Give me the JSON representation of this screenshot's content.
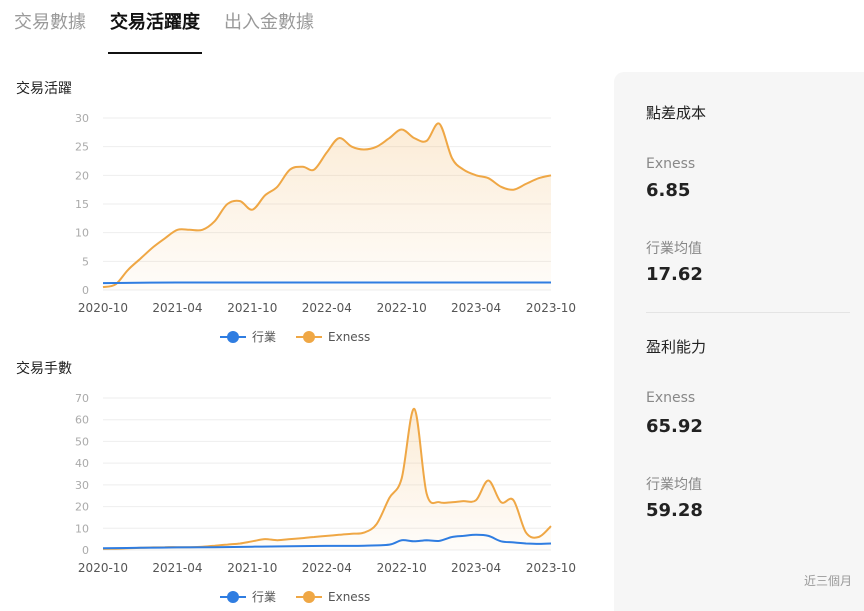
{
  "tabs": [
    {
      "label": "交易數據",
      "active": false
    },
    {
      "label": "交易活躍度",
      "active": true
    },
    {
      "label": "出入金數據",
      "active": false
    }
  ],
  "legend": {
    "industry": "行業",
    "broker": "Exness"
  },
  "colors": {
    "industry": "#2f7de1",
    "broker": "#efa745",
    "grid": "#eeeeee"
  },
  "panel": {
    "spread_title": "點差成本",
    "spread_broker_label": "Exness",
    "spread_broker_value": "6.85",
    "spread_industry_label": "行業均值",
    "spread_industry_value": "17.62",
    "profit_title": "盈利能力",
    "profit_broker_label": "Exness",
    "profit_broker_value": "65.92",
    "profit_industry_label": "行業均值",
    "profit_industry_value": "59.28",
    "footnote": "近三個月"
  },
  "chart_data": [
    {
      "type": "area",
      "title": "交易活躍",
      "x_tick_labels": [
        "2020-10",
        "2021-04",
        "2021-10",
        "2022-04",
        "2022-10",
        "2023-04",
        "2023-10"
      ],
      "x_range": [
        "2020-10-01",
        "2023-10-01"
      ],
      "ylim": [
        0,
        30
      ],
      "y_ticks": [
        0,
        5,
        10,
        15,
        20,
        25,
        30
      ],
      "grid": true,
      "legend_position": "bottom-center",
      "series": [
        {
          "name": "行業",
          "x": [
            "2020-10-01",
            "2021-04-01",
            "2021-10-01",
            "2022-04-01",
            "2022-10-01",
            "2023-04-01",
            "2023-10-01"
          ],
          "y": [
            1.2,
            1.3,
            1.3,
            1.3,
            1.3,
            1.3,
            1.3
          ]
        },
        {
          "name": "Exness",
          "x": [
            "2020-10-01",
            "2020-11-01",
            "2020-12-01",
            "2021-01-01",
            "2021-02-01",
            "2021-03-01",
            "2021-04-01",
            "2021-05-01",
            "2021-06-01",
            "2021-07-01",
            "2021-08-01",
            "2021-09-01",
            "2021-10-01",
            "2021-11-01",
            "2021-12-01",
            "2022-01-01",
            "2022-02-01",
            "2022-03-01",
            "2022-04-01",
            "2022-05-01",
            "2022-06-01",
            "2022-07-01",
            "2022-08-01",
            "2022-09-01",
            "2022-10-01",
            "2022-11-01",
            "2022-12-01",
            "2023-01-01",
            "2023-02-01",
            "2023-03-01",
            "2023-04-01",
            "2023-05-01",
            "2023-06-01",
            "2023-07-01",
            "2023-08-01",
            "2023-09-01",
            "2023-10-01"
          ],
          "y": [
            0.5,
            1.0,
            3.5,
            5.5,
            7.5,
            9.0,
            10.5,
            10.5,
            10.5,
            12.0,
            15.0,
            15.5,
            14.0,
            16.5,
            18.0,
            21.0,
            21.5,
            21.0,
            24.0,
            26.5,
            25.0,
            24.5,
            25.0,
            26.5,
            28.0,
            26.5,
            26.0,
            29.0,
            23.0,
            21.0,
            20.0,
            19.5,
            18.0,
            17.5,
            18.5,
            19.5,
            20.0
          ]
        }
      ]
    },
    {
      "type": "area",
      "title": "交易手數",
      "x_tick_labels": [
        "2020-10",
        "2021-04",
        "2021-10",
        "2022-04",
        "2022-10",
        "2023-04",
        "2023-10"
      ],
      "x_range": [
        "2020-10-01",
        "2023-10-01"
      ],
      "ylim": [
        0,
        70
      ],
      "y_ticks": [
        0,
        10,
        20,
        30,
        40,
        50,
        60,
        70
      ],
      "grid": true,
      "legend_position": "bottom-center",
      "series": [
        {
          "name": "行業",
          "x": [
            "2020-10-01",
            "2021-01-01",
            "2021-04-01",
            "2021-07-01",
            "2021-10-01",
            "2022-01-01",
            "2022-04-01",
            "2022-07-01",
            "2022-09-01",
            "2022-10-01",
            "2022-11-01",
            "2022-12-01",
            "2023-01-01",
            "2023-02-01",
            "2023-03-01",
            "2023-04-01",
            "2023-05-01",
            "2023-06-01",
            "2023-07-01",
            "2023-08-01",
            "2023-09-01",
            "2023-10-01"
          ],
          "y": [
            0.8,
            1.0,
            1.2,
            1.3,
            1.5,
            1.7,
            1.9,
            2.0,
            2.5,
            4.5,
            4.0,
            4.5,
            4.2,
            6.0,
            6.5,
            7.0,
            6.5,
            4.0,
            3.5,
            3.0,
            2.8,
            3.0
          ]
        },
        {
          "name": "Exness",
          "x": [
            "2020-10-01",
            "2020-11-01",
            "2020-12-01",
            "2021-01-01",
            "2021-02-01",
            "2021-03-01",
            "2021-04-01",
            "2021-05-01",
            "2021-06-01",
            "2021-07-01",
            "2021-08-01",
            "2021-09-01",
            "2021-10-01",
            "2021-11-01",
            "2021-12-01",
            "2022-01-01",
            "2022-02-01",
            "2022-03-01",
            "2022-04-01",
            "2022-05-01",
            "2022-06-01",
            "2022-07-01",
            "2022-08-01",
            "2022-09-01",
            "2022-10-01",
            "2022-11-01",
            "2022-12-01",
            "2023-01-01",
            "2023-02-01",
            "2023-03-01",
            "2023-04-01",
            "2023-05-01",
            "2023-06-01",
            "2023-07-01",
            "2023-08-01",
            "2023-09-01",
            "2023-10-01"
          ],
          "y": [
            0.5,
            0.6,
            0.8,
            1.0,
            1.2,
            1.3,
            1.3,
            1.3,
            1.5,
            2.0,
            2.5,
            3.0,
            4.0,
            5.0,
            4.5,
            5.0,
            5.5,
            6.0,
            6.5,
            7.0,
            7.5,
            8.0,
            12.0,
            24.0,
            33.0,
            65.0,
            26.0,
            22.0,
            22.0,
            22.5,
            23.0,
            32.0,
            22.0,
            23.0,
            8.0,
            6.0,
            11.0
          ]
        }
      ]
    }
  ]
}
